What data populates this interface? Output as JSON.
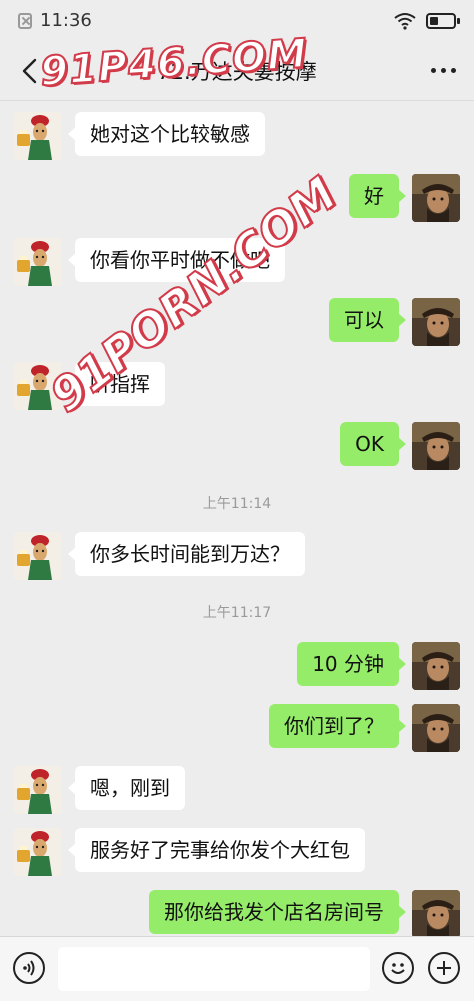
{
  "status_bar": {
    "time": "11:36",
    "battery_level": 0.35
  },
  "nav": {
    "title": "72.万达夫妻按摩"
  },
  "messages": [
    {
      "side": "left",
      "text": "她对这个比较敏感"
    },
    {
      "side": "right",
      "text": "好"
    },
    {
      "side": "left",
      "text": "你看你平时做不做吧"
    },
    {
      "side": "right",
      "text": "可以"
    },
    {
      "side": "left",
      "text": "听指挥"
    },
    {
      "side": "right",
      "text": "OK"
    },
    {
      "type": "time",
      "text": "上午11:14"
    },
    {
      "side": "left",
      "text": "你多长时间能到万达？"
    },
    {
      "type": "time",
      "text": "上午11:17"
    },
    {
      "side": "right",
      "text": "10 分钟"
    },
    {
      "side": "right",
      "text": "你们到了？"
    },
    {
      "side": "left",
      "text": "嗯，刚到"
    },
    {
      "side": "left",
      "text": "服务好了完事给你发个大红包"
    },
    {
      "side": "right",
      "text": "那你给我发个店名房间号"
    }
  ],
  "watermarks": [
    "91P46.COM",
    "91PORN.COM"
  ],
  "input": {
    "value": ""
  }
}
